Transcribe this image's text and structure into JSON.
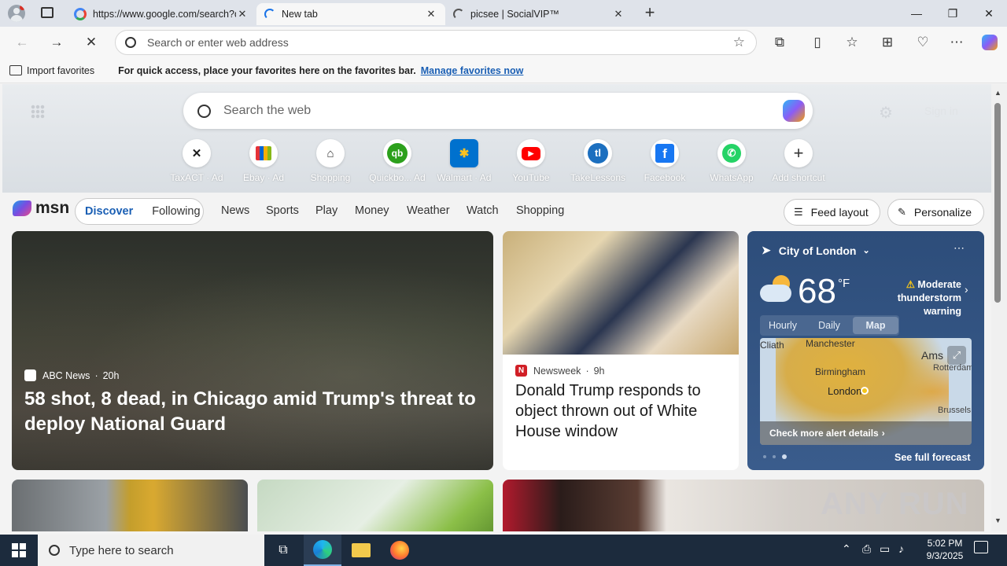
{
  "browser": {
    "tabs": [
      {
        "title": "https://www.google.com/search?q=",
        "icon": "google-icon"
      },
      {
        "title": "New tab",
        "icon": "loading-icon"
      },
      {
        "title": "picsee | SocialVIP™",
        "icon": "loading-icon"
      }
    ],
    "address_placeholder": "Search or enter web address",
    "favbar": {
      "import_label": "Import favorites",
      "hint": "For quick access, place your favorites here on the favorites bar.",
      "manage_link": "Manage favorites now"
    }
  },
  "newtab": {
    "search_placeholder": "Search the web",
    "sign_in": "Sign in",
    "shortcuts": [
      {
        "label": "TaxACT",
        "ad": "· Ad",
        "icon": "taxact-icon",
        "color": "#1a1a1a"
      },
      {
        "label": "Ebay",
        "ad": "· Ad",
        "icon": "ebay-bag-icon",
        "color": "#e53238"
      },
      {
        "label": "Shopping",
        "ad": "",
        "icon": "tag-icon",
        "color": "#333333"
      },
      {
        "label": "Quickbo...",
        "ad": "Ad",
        "icon": "quickbooks-icon",
        "color": "#2ca01c"
      },
      {
        "label": "Walmart",
        "ad": "· Ad",
        "icon": "walmart-spark-icon",
        "color": "#0071ce"
      },
      {
        "label": "YouTube",
        "ad": "",
        "icon": "youtube-icon",
        "color": "#ff0000"
      },
      {
        "label": "TakeLessons",
        "ad": "",
        "icon": "takelessons-icon",
        "color": "#1c6fbf"
      },
      {
        "label": "Facebook",
        "ad": "",
        "icon": "facebook-icon",
        "color": "#1877f2"
      },
      {
        "label": "WhatsApp",
        "ad": "",
        "icon": "whatsapp-icon",
        "color": "#25d366"
      },
      {
        "label": "Add shortcut",
        "ad": "",
        "icon": "plus-icon",
        "color": "#333333"
      }
    ]
  },
  "msn": {
    "logo": "msn",
    "tabs": [
      "Discover",
      "Following"
    ],
    "nav": [
      "News",
      "Sports",
      "Play",
      "Money",
      "Weather",
      "Watch",
      "Shopping"
    ],
    "feed_layout": "Feed layout",
    "personalize": "Personalize"
  },
  "cards": {
    "main": {
      "source": "ABC News",
      "age": "20h",
      "headline": "58 shot, 8 dead, in Chicago amid Trump's threat to deploy National Guard"
    },
    "second": {
      "source": "Newsweek",
      "age": "9h",
      "headline": "Donald Trump responds to object thrown out of White House window"
    }
  },
  "weather": {
    "location": "City of London",
    "temp": "68",
    "unit": "°F",
    "alert": "Moderate thunderstorm warning",
    "tabs": [
      "Hourly",
      "Daily",
      "Map"
    ],
    "active_tab": "Map",
    "map_labels": [
      "Manchester",
      "Birmingham",
      "London",
      "Ams",
      "Rotterdam",
      "Brussels",
      "Cliath"
    ],
    "alert_link": "Check more alert details",
    "full_forecast": "See full forecast"
  },
  "taskbar": {
    "search_placeholder": "Type here to search",
    "time": "5:02 PM",
    "date": "9/3/2025"
  },
  "watermark": "ANY RUN"
}
